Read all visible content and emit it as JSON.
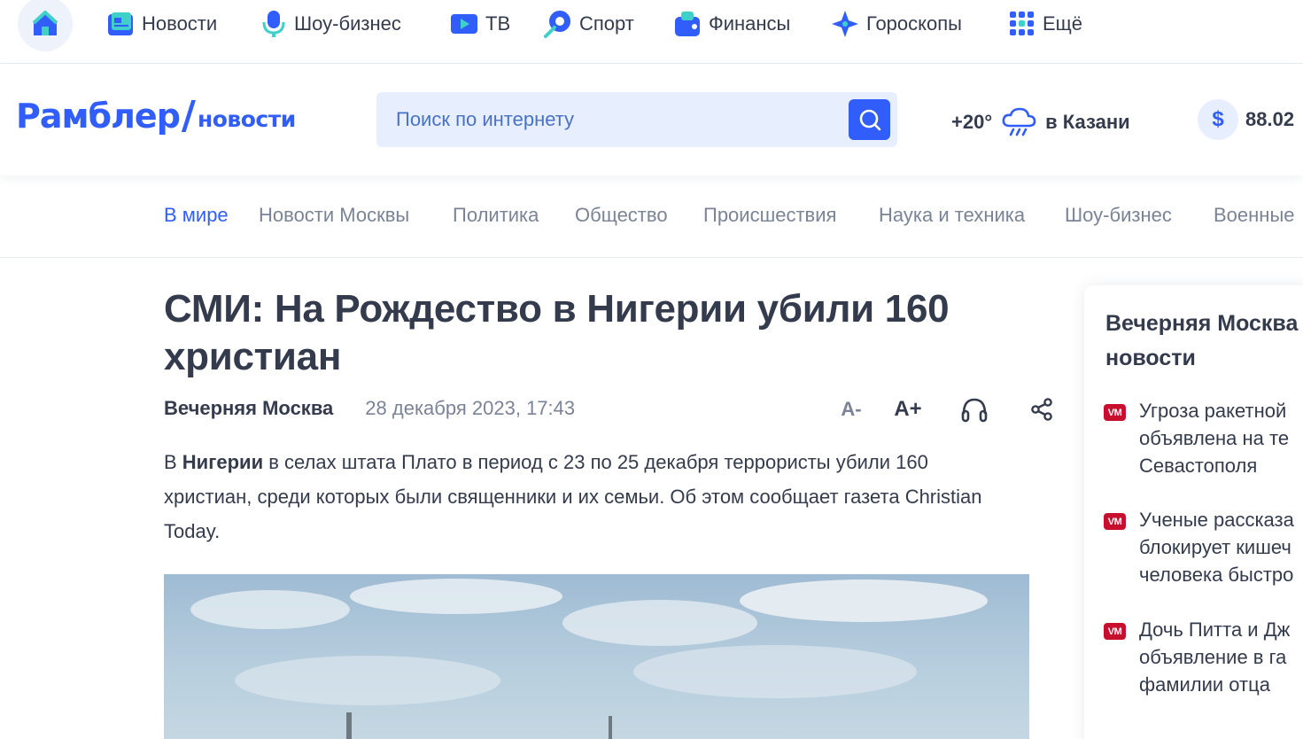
{
  "topbar": {
    "items": [
      {
        "label": "Новости",
        "icon": "newspaper-icon"
      },
      {
        "label": "Шоу-бизнес",
        "icon": "microphone-icon"
      },
      {
        "label": "ТВ",
        "icon": "tv-play-icon"
      },
      {
        "label": "Спорт",
        "icon": "ball-icon"
      },
      {
        "label": "Финансы",
        "icon": "wallet-icon"
      },
      {
        "label": "Гороскопы",
        "icon": "star-icon"
      },
      {
        "label": "Ещё",
        "icon": "grid-icon"
      }
    ]
  },
  "header": {
    "logo_main": "Рамблер",
    "logo_slash": "/",
    "logo_sub": "новости",
    "search_placeholder": "Поиск по интернету",
    "weather_temp": "+20°",
    "weather_city": "в Казани",
    "currency_symbol": "$",
    "currency_value": "88.02"
  },
  "rubrics": {
    "items": [
      "В мире",
      "Новости Москвы",
      "Политика",
      "Общество",
      "Происшествия",
      "Наука и техника",
      "Шоу-бизнес",
      "Военные"
    ],
    "active": "В мире"
  },
  "article": {
    "title": "СМИ: На Рождество в Нигерии убили 160 христиан",
    "source": "Вечерняя Москва",
    "date": "28 декабря 2023, 17:43",
    "tools": {
      "font_decrease": "A-",
      "font_increase": "A+"
    },
    "lead_prefix": "В ",
    "lead_bold": "Нигерии",
    "lead_rest": " в селах штата Плато в период с 23 по 25 декабря террористы убили 160 христиан, среди которых были священники и их семьи. Об этом сообщает газета Christian Today."
  },
  "sidebar": {
    "title": "Вечерняя Москва новости",
    "badge": "VM",
    "items": [
      "Угроза ракетной объявлена на те Севастополя",
      "Ученые рассказа блокирует кишеч человека быстро",
      "Дочь Питта и Дж объявление в га фамилии отца"
    ]
  },
  "colors": {
    "brand": "#315efb",
    "text": "#343b4c",
    "muted": "#7a8496",
    "search_bg": "#e7efff",
    "vm_badge": "#c8102e"
  }
}
